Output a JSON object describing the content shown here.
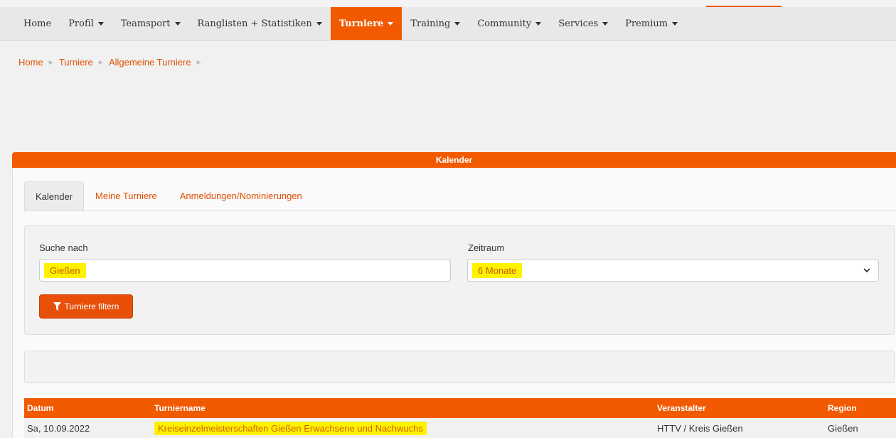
{
  "nav": {
    "items": [
      {
        "label": "Home",
        "caret": false,
        "active": false
      },
      {
        "label": "Profil",
        "caret": true,
        "active": false
      },
      {
        "label": "Teamsport",
        "caret": true,
        "active": false
      },
      {
        "label": "Ranglisten + Statistiken",
        "caret": true,
        "active": false
      },
      {
        "label": "Turniere",
        "caret": true,
        "active": true
      },
      {
        "label": "Training",
        "caret": true,
        "active": false
      },
      {
        "label": "Community",
        "caret": true,
        "active": false
      },
      {
        "label": "Services",
        "caret": true,
        "active": false
      },
      {
        "label": "Premium",
        "caret": true,
        "active": false
      }
    ]
  },
  "breadcrumb": [
    "Home",
    "Turniere",
    "Allgemeine Turniere"
  ],
  "panel": {
    "title": "Kalender"
  },
  "tabs": [
    {
      "label": "Kalender",
      "active": true
    },
    {
      "label": "Meine Turniere",
      "active": false
    },
    {
      "label": "Anmeldungen/Nominierungen",
      "active": false
    }
  ],
  "filter": {
    "search_label": "Suche nach",
    "search_value": "Gießen",
    "period_label": "Zeitraum",
    "period_value": "6 Monate",
    "button_label": "Turniere filtern"
  },
  "table": {
    "headers": [
      "Datum",
      "Turniername",
      "Veranstalter",
      "Region"
    ],
    "rows": [
      {
        "datum": "Sa, 10.09.2022",
        "name": "Kreiseinzelmeisterschaften Gießen Erwachsene und Nachwuchs",
        "veranstalter": "HTTV / Kreis Gießen",
        "region": "Gießen"
      }
    ]
  },
  "colors": {
    "accent": "#f15a00",
    "highlight": "#fff200",
    "link": "#e05000"
  }
}
